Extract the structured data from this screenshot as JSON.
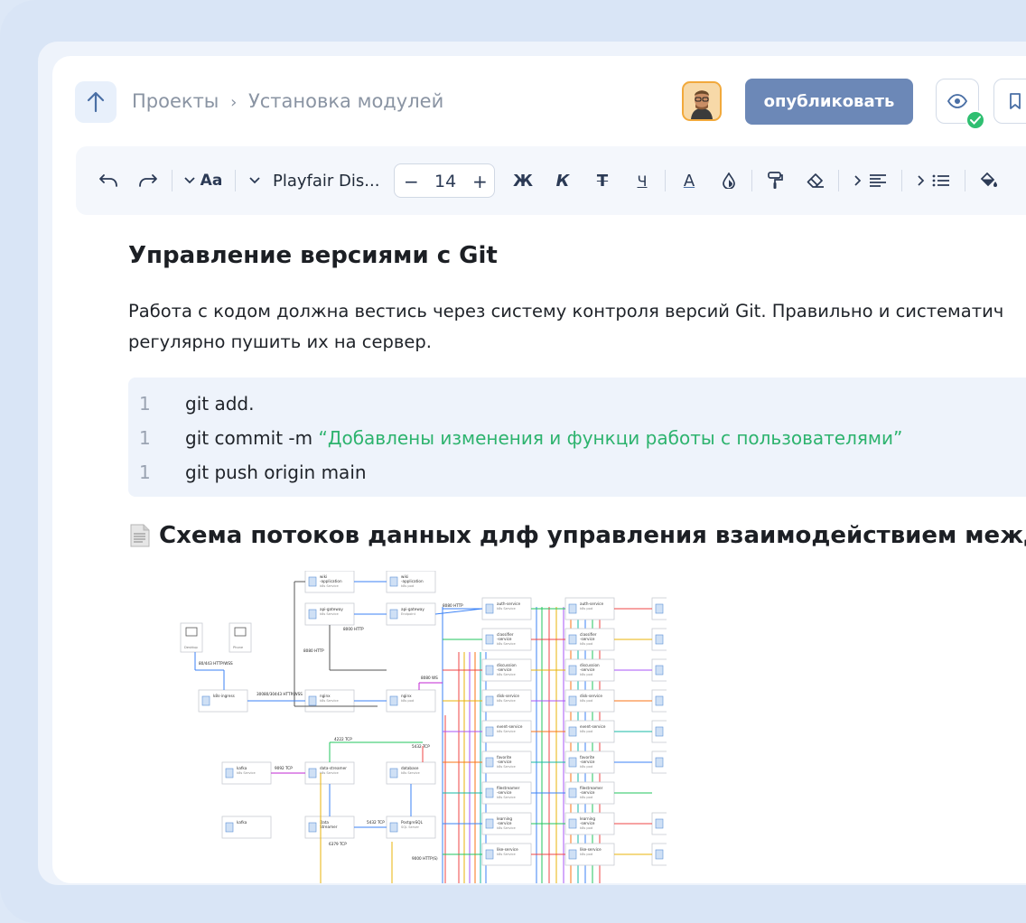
{
  "header": {
    "breadcrumb": [
      "Проекты",
      "Установка модулей"
    ],
    "publish_label": "опубликовать"
  },
  "toolbar": {
    "font_name": "Playfair Dis...",
    "font_size": "14",
    "minus": "−",
    "plus": "+",
    "bold": "Ж",
    "italic": "К",
    "strike": "Т",
    "underline": "Ч",
    "text_color": "А",
    "case_label": "Aa"
  },
  "content": {
    "heading": "Управление версиями с Git",
    "paragraph_line1": "Работа с кодом должна вестись через систему контроля версий Git. Правильно и систематич",
    "paragraph_line2": "регулярно пушить их на сервер.",
    "code": [
      {
        "num": "1",
        "cmd": "git add.",
        "str": ""
      },
      {
        "num": "1",
        "cmd": "git commit -m ",
        "str": "“Добавлены изменения и функци работы с пользователями”"
      },
      {
        "num": "1",
        "cmd": "git push origin main",
        "str": ""
      }
    ],
    "diagram_heading": "Схема потоков данных длф управления взаимодействием между с"
  },
  "diagram": {
    "left_nodes": [
      {
        "title": "wiki -application",
        "sub": "k8s Service"
      },
      {
        "title": "api-gateway",
        "sub": "k8s Service"
      },
      {
        "title": "nginx",
        "sub": "k8s Service"
      },
      {
        "title": "data-streamer",
        "sub": "k8s Service"
      },
      {
        "title": "kafka",
        "sub": "k8s Service"
      },
      {
        "title": "kafka",
        "sub": ""
      },
      {
        "title": "Data Streamer",
        "sub": ""
      },
      {
        "title": "database",
        "sub": "k8s Service"
      },
      {
        "title": "PostgreSQL",
        "sub": "SQL Server"
      },
      {
        "title": "k8s-ingress",
        "sub": ""
      }
    ],
    "mid_nodes": [
      {
        "title": "wiki -application",
        "sub": "k8s pod"
      },
      {
        "title": "api-gateway",
        "sub": "Endpoint"
      },
      {
        "title": "nginx",
        "sub": "k8s pod"
      }
    ],
    "clients": [
      "Desktop",
      "Phone"
    ],
    "services": [
      "auth-service",
      "classifier -service",
      "discussion -service",
      "disk-service",
      "event-service",
      "favorite -service",
      "filestreamer -service",
      "learning -service",
      "like-service"
    ],
    "bg_services": [
      "auth-service-bg",
      "classifier -service-bg",
      "discussion -service-bg",
      "disk-service-bg",
      "event-service-bg",
      "favorite -service-bg",
      "",
      "learning-service-bg",
      "like-service-bg"
    ],
    "labels": [
      "8080 HTTP",
      "8000 HTTP",
      "8080 HTTP",
      "80/443 HTTP/WSS",
      "30080/30443 HTTP/WSS",
      "8080 WS",
      "4222 TCP",
      "5432 TCP",
      "9092 TCP",
      "5432 TCP",
      "6379 TCP",
      "9000 HTTP(S)"
    ]
  },
  "colors": {
    "publish_bg": "#6c88b7",
    "code_string": "#2db36e",
    "check_badge": "#2fbf71"
  }
}
